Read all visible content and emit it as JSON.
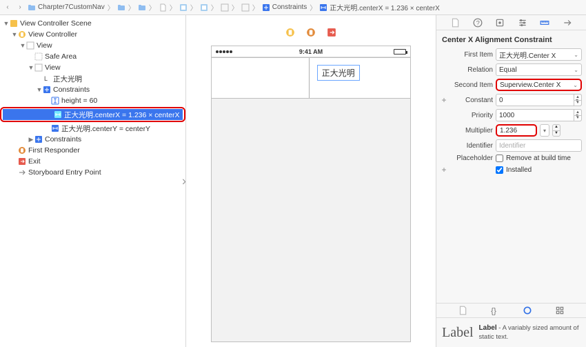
{
  "breadcrumb": {
    "back": "‹",
    "fwd": "›",
    "items": [
      {
        "label": "Charpter7CustomNav"
      },
      {
        "label": ""
      },
      {
        "label": ""
      },
      {
        "label": ""
      },
      {
        "label": ""
      },
      {
        "label": ""
      },
      {
        "label": ""
      },
      {
        "label": ""
      },
      {
        "label": "Constraints"
      },
      {
        "label": "正大光明.centerX = 1.236 × centerX"
      }
    ]
  },
  "outline": {
    "rows": [
      {
        "depth": 0,
        "exp": "▼",
        "icon": "scene",
        "label": "View Controller Scene"
      },
      {
        "depth": 1,
        "exp": "▼",
        "icon": "vc",
        "label": "View Controller"
      },
      {
        "depth": 2,
        "exp": "▼",
        "icon": "view",
        "label": "View"
      },
      {
        "depth": 3,
        "exp": "",
        "icon": "safe",
        "label": "Safe Area"
      },
      {
        "depth": 3,
        "exp": "▼",
        "icon": "view",
        "label": "View"
      },
      {
        "depth": 4,
        "exp": "",
        "icon": "label",
        "label": "正大光明"
      },
      {
        "depth": 4,
        "exp": "▼",
        "icon": "constraints",
        "label": "Constraints"
      },
      {
        "depth": 5,
        "exp": "",
        "icon": "cH",
        "label": "height = 60"
      },
      {
        "depth": 5,
        "exp": "",
        "icon": "cX",
        "label": "正大光明.centerX = 1.236 × centerX",
        "selected": true,
        "red": true
      },
      {
        "depth": 5,
        "exp": "",
        "icon": "cX",
        "label": "正大光明.centerY = centerY"
      },
      {
        "depth": 3,
        "exp": "▶",
        "icon": "constraints",
        "label": "Constraints"
      },
      {
        "depth": 1,
        "exp": "",
        "icon": "fr",
        "label": "First Responder"
      },
      {
        "depth": 1,
        "exp": "",
        "icon": "exit",
        "label": "Exit"
      },
      {
        "depth": 1,
        "exp": "",
        "icon": "entry",
        "label": "Storyboard Entry Point"
      }
    ]
  },
  "canvas": {
    "statusTime": "9:41 AM",
    "labelText": "正大光明"
  },
  "inspector": {
    "title": "Center X Alignment Constraint",
    "firstItem": {
      "label": "First Item",
      "value": "正大光明.Center X"
    },
    "relation": {
      "label": "Relation",
      "value": "Equal"
    },
    "secondItem": {
      "label": "Second Item",
      "value": "Superview.Center X",
      "red": true
    },
    "constant": {
      "label": "Constant",
      "value": "0"
    },
    "priority": {
      "label": "Priority",
      "value": "1000"
    },
    "multiplier": {
      "label": "Multiplier",
      "value": "1.236",
      "red": true
    },
    "identifier": {
      "label": "Identifier",
      "placeholder": "Identifier"
    },
    "placeholder": {
      "label": "Placeholder",
      "checkLabel": "Remove at build time",
      "checked": false
    },
    "installed": {
      "checkLabel": "Installed",
      "checked": true
    }
  },
  "library": {
    "itemName": "Label",
    "itemBold": "Label",
    "itemDesc": " - A variably sized amount of static text."
  },
  "colors": {
    "sel": "#3a75ed",
    "red": "#e10000"
  }
}
